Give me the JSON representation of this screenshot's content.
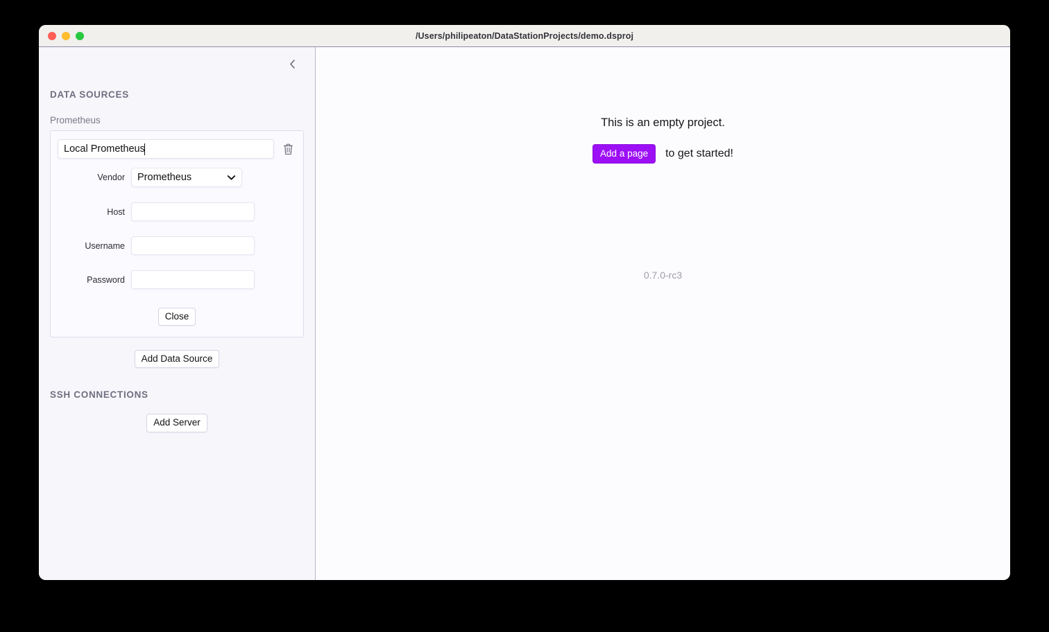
{
  "window": {
    "title": "/Users/philipeaton/DataStationProjects/demo.dsproj",
    "traffic_lights": [
      "close-red",
      "minimize-yellow",
      "maximize-green"
    ]
  },
  "sidebar": {
    "collapse_icon": "chevron-left-icon",
    "data_sources": {
      "heading": "DATA SOURCES",
      "items": [
        {
          "label": "Prometheus",
          "name_value": "Local Prometheus",
          "delete_icon": "trash-icon",
          "fields": [
            {
              "label": "Vendor",
              "type": "select",
              "value": "Prometheus",
              "chevron": "chevron-down-icon"
            },
            {
              "label": "Host",
              "type": "text",
              "value": ""
            },
            {
              "label": "Username",
              "type": "text",
              "value": ""
            },
            {
              "label": "Password",
              "type": "password",
              "value": ""
            }
          ],
          "close_label": "Close"
        }
      ],
      "add_label": "Add Data Source"
    },
    "ssh_connections": {
      "heading": "SSH CONNECTIONS",
      "add_label": "Add Server"
    }
  },
  "main": {
    "empty_title": "This is an empty project.",
    "add_page_label": "Add a page",
    "cta_suffix": "to get started!",
    "version": "0.7.0-rc3"
  },
  "colors": {
    "accent": "#9d10f5",
    "sidebar_bg": "#f7f6fb",
    "main_bg": "#fcfcfe",
    "titlebar_bg": "#f1f0ed",
    "heading_text": "#6f6f80",
    "traffic_close": "#ff5f57",
    "traffic_min": "#febc2e",
    "traffic_max": "#28c840"
  }
}
